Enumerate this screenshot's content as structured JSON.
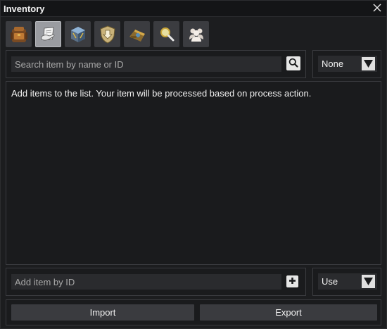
{
  "window": {
    "title": "Inventory",
    "close_icon": "close-icon"
  },
  "toolbar": {
    "tools": [
      {
        "name": "backpack",
        "icon": "backpack-icon",
        "active": false
      },
      {
        "name": "process",
        "icon": "paper-hand-icon",
        "active": true
      },
      {
        "name": "cube",
        "icon": "cube-icon",
        "active": false
      },
      {
        "name": "shield-down",
        "icon": "shield-arrow-icon",
        "active": false
      },
      {
        "name": "bag",
        "icon": "bag-icon",
        "active": false
      },
      {
        "name": "search",
        "icon": "magnifier-icon",
        "active": false
      },
      {
        "name": "group",
        "icon": "group-icon",
        "active": false
      }
    ]
  },
  "search": {
    "placeholder": "Search item by name or ID",
    "value": ""
  },
  "filter": {
    "selected": "None"
  },
  "list": {
    "hint": "Add items to the list. Your item will be processed based on process action."
  },
  "add_item": {
    "placeholder": "Add item by ID",
    "value": ""
  },
  "action": {
    "selected": "Use"
  },
  "buttons": {
    "import_label": "Import",
    "export_label": "Export"
  },
  "colors": {
    "background": "#1c1d1f",
    "panel_border": "#3a3b3f",
    "input_bg": "#2a2b2e",
    "active_tool": "#9a9ca1",
    "text": "#f0f0f0"
  }
}
